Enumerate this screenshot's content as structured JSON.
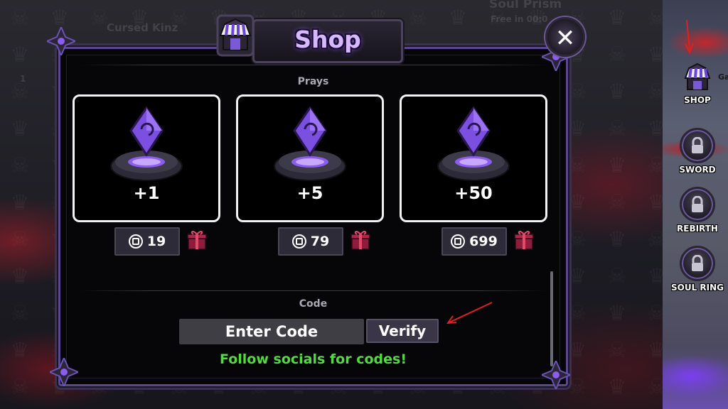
{
  "background": {
    "top_left_text": "Cursed Kinz",
    "top_right_text": "Soul Prism",
    "top_right_sub": "Free in 00:0",
    "left_number": "1"
  },
  "shop": {
    "title": "Shop",
    "close_label": "✕",
    "prays_label": "Prays",
    "items": [
      {
        "amount": "+1",
        "price": "19"
      },
      {
        "amount": "+5",
        "price": "79"
      },
      {
        "amount": "+50",
        "price": "699"
      }
    ],
    "code_label": "Code",
    "code_placeholder": "Enter Code",
    "verify_label": "Verify",
    "socials_text": "Follow socials for codes!"
  },
  "sidebar": {
    "items": [
      {
        "label": "SHOP",
        "icon": "shop-icon"
      },
      {
        "label": "SWORD",
        "icon": "lock-icon"
      },
      {
        "label": "REBIRTH",
        "icon": "lock-icon"
      },
      {
        "label": "SOUL RING",
        "icon": "lock-icon"
      }
    ],
    "edge_text": "Ga"
  },
  "colors": {
    "accent": "#6a4fb0",
    "title": "#d6b8ff",
    "socials": "#4fdc3c",
    "arrow": "#e0201f"
  }
}
